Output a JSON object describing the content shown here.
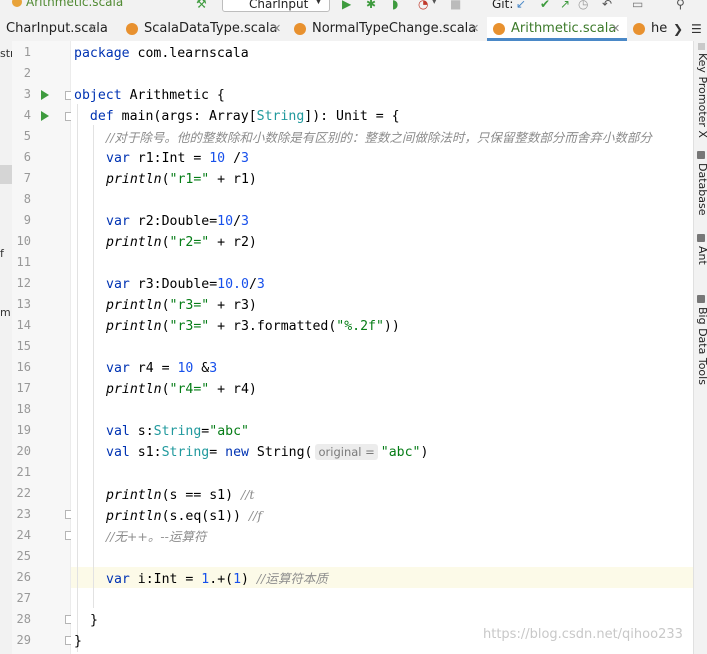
{
  "toolbar": {
    "breadcrumb": "Arithmetic.scala",
    "run_config": "CharInput",
    "run_config_icon": "scala-object-icon",
    "git_label": "Git:"
  },
  "tabs": [
    {
      "label": "CharInput.scala",
      "active": false
    },
    {
      "label": "ScalaDataType.scala",
      "active": false
    },
    {
      "label": "NormalTypeChange.scala",
      "active": false
    },
    {
      "label": "Arithmetic.scala",
      "active": true
    },
    {
      "label": "he",
      "active": false
    }
  ],
  "tabs_overflow": "chevron-down-icon",
  "left_strip": [
    "str",
    "f",
    "m"
  ],
  "editor": {
    "file": "Arithmetic.scala",
    "current_line": 26,
    "line_numbers": [
      "1",
      "2",
      "3",
      "4",
      "5",
      "6",
      "7",
      "8",
      "9",
      "10",
      "11",
      "12",
      "13",
      "14",
      "15",
      "16",
      "17",
      "18",
      "19",
      "20",
      "21",
      "22",
      "23",
      "24",
      "25",
      "26",
      "27",
      "28",
      "29"
    ],
    "lines": {
      "l1": [
        "package",
        " com.learnscala"
      ],
      "l3": [
        "object",
        " Arithmetic {"
      ],
      "l4": [
        "  ",
        "def",
        " main(args: Array[",
        "String",
        "]): Unit = {"
      ],
      "l5": "//对于除号。他的整数除和小数除是有区别的：整数之间做除法时，只保留整数部分而舍弃小数部分",
      "l6": [
        "var",
        " r1:Int = ",
        "10",
        " /",
        "3"
      ],
      "l7": [
        "println",
        "(",
        "\"r1=\"",
        " + r1)"
      ],
      "l9": [
        "var",
        " r2:Double=",
        "10",
        "/",
        "3"
      ],
      "l10": [
        "println",
        "(",
        "\"r2=\"",
        " + r2)"
      ],
      "l12": [
        "var",
        " r3:Double=",
        "10.0",
        "/",
        "3"
      ],
      "l13": [
        "println",
        "(",
        "\"r3=\"",
        " + r3)"
      ],
      "l14": [
        "println",
        "(",
        "\"r3=\"",
        " + r3.formatted(",
        "\"%.2f\"",
        "))"
      ],
      "l16": [
        "var",
        " r4 = ",
        "10",
        " &",
        "3"
      ],
      "l17": [
        "println",
        "(",
        "\"r4=\"",
        " + r4)"
      ],
      "l19": [
        "val",
        " s:",
        "String",
        "=",
        "\"abc\""
      ],
      "l20": [
        "val",
        " s1:",
        "String",
        "= ",
        "new",
        " String(",
        "original =",
        "\"abc\"",
        ")"
      ],
      "l22": [
        "println",
        "(s == s1) ",
        "//t"
      ],
      "l23": [
        "println",
        "(s.eq(s1)) ",
        "//f"
      ],
      "l24": "//无++。--运算符",
      "l26": [
        "var",
        " i:Int = ",
        "1",
        ".+(",
        "1",
        ") ",
        "//运算符本质"
      ],
      "l28": "}",
      "l29": "}"
    }
  },
  "right_panel": [
    "Key Promoter X",
    "Database",
    "Ant",
    "Big Data Tools"
  ],
  "watermark": "https://blog.csdn.net/qihoo233"
}
